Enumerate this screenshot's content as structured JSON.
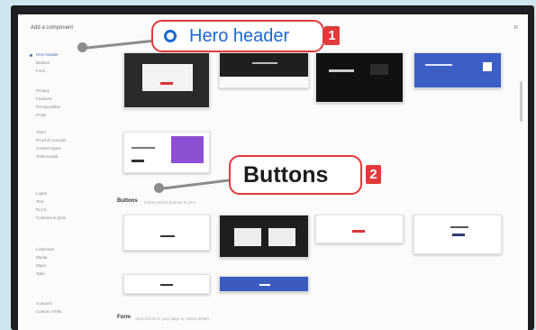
{
  "dialog": {
    "title": "Add a component",
    "close_icon": "close-icon"
  },
  "sidebar": {
    "items": [
      {
        "label": "Hero header",
        "active": true
      },
      {
        "label": "Buttons"
      },
      {
        "label": "Form"
      },
      {
        "label": "Privacy"
      },
      {
        "label": "Features"
      },
      {
        "label": "Pricing tables"
      },
      {
        "label": "FAQs"
      },
      {
        "label": "Team"
      },
      {
        "label": "Proof of concept"
      },
      {
        "label": "Content types"
      },
      {
        "label": "Testimonials"
      },
      {
        "label": "Logos"
      },
      {
        "label": "Text"
      },
      {
        "label": "FLCS"
      },
      {
        "label": "Columns & grids"
      },
      {
        "label": "Lists/rows"
      },
      {
        "label": "Media"
      },
      {
        "label": "Maps"
      },
      {
        "label": "Tabs"
      },
      {
        "label": "Contacts"
      },
      {
        "label": "Custom HTML"
      }
    ]
  },
  "sections": {
    "buttons_title": "Buttons",
    "buttons_desc": "Call-to-action buttons in your",
    "form_title": "Form",
    "form_desc": "Short forms in your page to collect details"
  },
  "callouts": [
    {
      "text": "Hero header",
      "badge": "1",
      "icon": "radio-icon",
      "color": "#1c69d3"
    },
    {
      "text": "Buttons",
      "badge": "2",
      "color": "#1c1c1c"
    }
  ],
  "colors": {
    "accent": "#e03a3a",
    "link": "#1c69d3",
    "background": "#cfe6ee"
  }
}
